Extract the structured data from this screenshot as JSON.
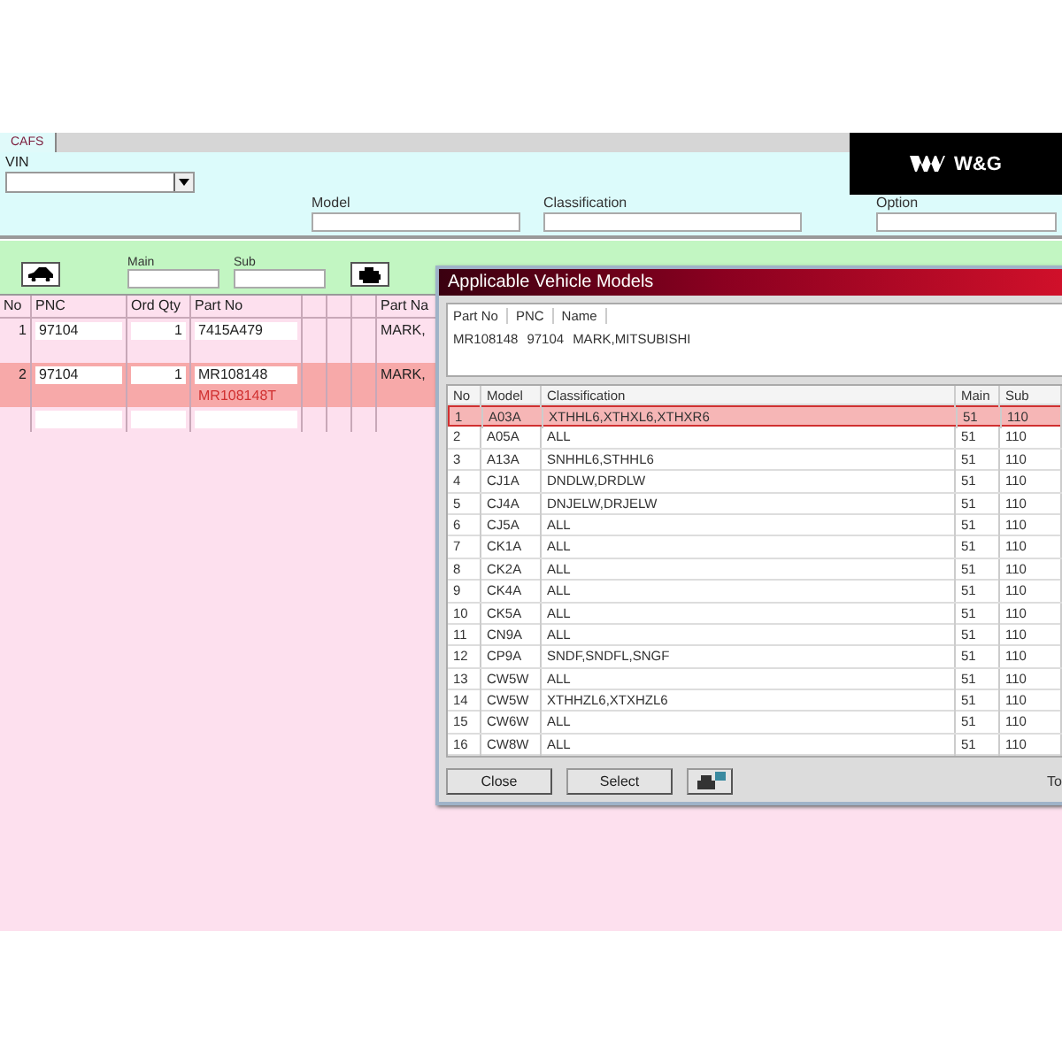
{
  "tabs": [
    {
      "label": "CAFS",
      "selected": true
    }
  ],
  "logo": {
    "text": "W&G"
  },
  "vin": {
    "label": "VIN"
  },
  "fields": [
    {
      "label": "Model"
    },
    {
      "label": "Classification"
    },
    {
      "label": "Option"
    }
  ],
  "group_bar": {
    "main_label": "Main",
    "sub_label": "Sub"
  },
  "parts_table": {
    "columns": [
      "No",
      "PNC",
      "Ord Qty",
      "Part No",
      "",
      "",
      "",
      "Part Na"
    ],
    "rows": [
      {
        "no": "1",
        "pnc": "97104",
        "qty": "1",
        "part_no": "7415A479",
        "name": "MARK,",
        "selected": false
      },
      {
        "no": "2",
        "pnc": "97104",
        "qty": "1",
        "part_no": "MR108148",
        "alt_part_no": "MR108148T",
        "name": "MARK,",
        "selected": true
      }
    ]
  },
  "dialog": {
    "title": "Applicable Vehicle Models",
    "info_columns": [
      "Part No",
      "PNC",
      "Name"
    ],
    "info_values": [
      "MR108148",
      "97104",
      "MARK,MITSUBISHI"
    ],
    "columns": [
      "No",
      "Model",
      "Classification",
      "Main",
      "Sub"
    ],
    "rows": [
      {
        "no": "1",
        "model": "A03A",
        "classification": "XTHHL6,XTHXL6,XTHXR6",
        "main": "51",
        "sub": "110",
        "selected": true
      },
      {
        "no": "2",
        "model": "A05A",
        "classification": "ALL",
        "main": "51",
        "sub": "110",
        "selected": false
      },
      {
        "no": "3",
        "model": "A13A",
        "classification": "SNHHL6,STHHL6",
        "main": "51",
        "sub": "110",
        "selected": false
      },
      {
        "no": "4",
        "model": "CJ1A",
        "classification": "DNDLW,DRDLW",
        "main": "51",
        "sub": "110",
        "selected": false
      },
      {
        "no": "5",
        "model": "CJ4A",
        "classification": "DNJELW,DRJELW",
        "main": "51",
        "sub": "110",
        "selected": false
      },
      {
        "no": "6",
        "model": "CJ5A",
        "classification": "ALL",
        "main": "51",
        "sub": "110",
        "selected": false
      },
      {
        "no": "7",
        "model": "CK1A",
        "classification": "ALL",
        "main": "51",
        "sub": "110",
        "selected": false
      },
      {
        "no": "8",
        "model": "CK2A",
        "classification": "ALL",
        "main": "51",
        "sub": "110",
        "selected": false
      },
      {
        "no": "9",
        "model": "CK4A",
        "classification": "ALL",
        "main": "51",
        "sub": "110",
        "selected": false
      },
      {
        "no": "10",
        "model": "CK5A",
        "classification": "ALL",
        "main": "51",
        "sub": "110",
        "selected": false
      },
      {
        "no": "11",
        "model": "CN9A",
        "classification": "ALL",
        "main": "51",
        "sub": "110",
        "selected": false
      },
      {
        "no": "12",
        "model": "CP9A",
        "classification": "SNDF,SNDFL,SNGF",
        "main": "51",
        "sub": "110",
        "selected": false
      },
      {
        "no": "13",
        "model": "CW5W",
        "classification": "ALL",
        "main": "51",
        "sub": "110",
        "selected": false
      },
      {
        "no": "14",
        "model": "CW5W",
        "classification": "XTHHZL6,XTXHZL6",
        "main": "51",
        "sub": "110",
        "selected": false
      },
      {
        "no": "15",
        "model": "CW6W",
        "classification": "ALL",
        "main": "51",
        "sub": "110",
        "selected": false
      },
      {
        "no": "16",
        "model": "CW8W",
        "classification": "ALL",
        "main": "51",
        "sub": "110",
        "selected": false
      }
    ],
    "buttons": [
      "Close",
      "Select"
    ],
    "footer_text": "To"
  }
}
